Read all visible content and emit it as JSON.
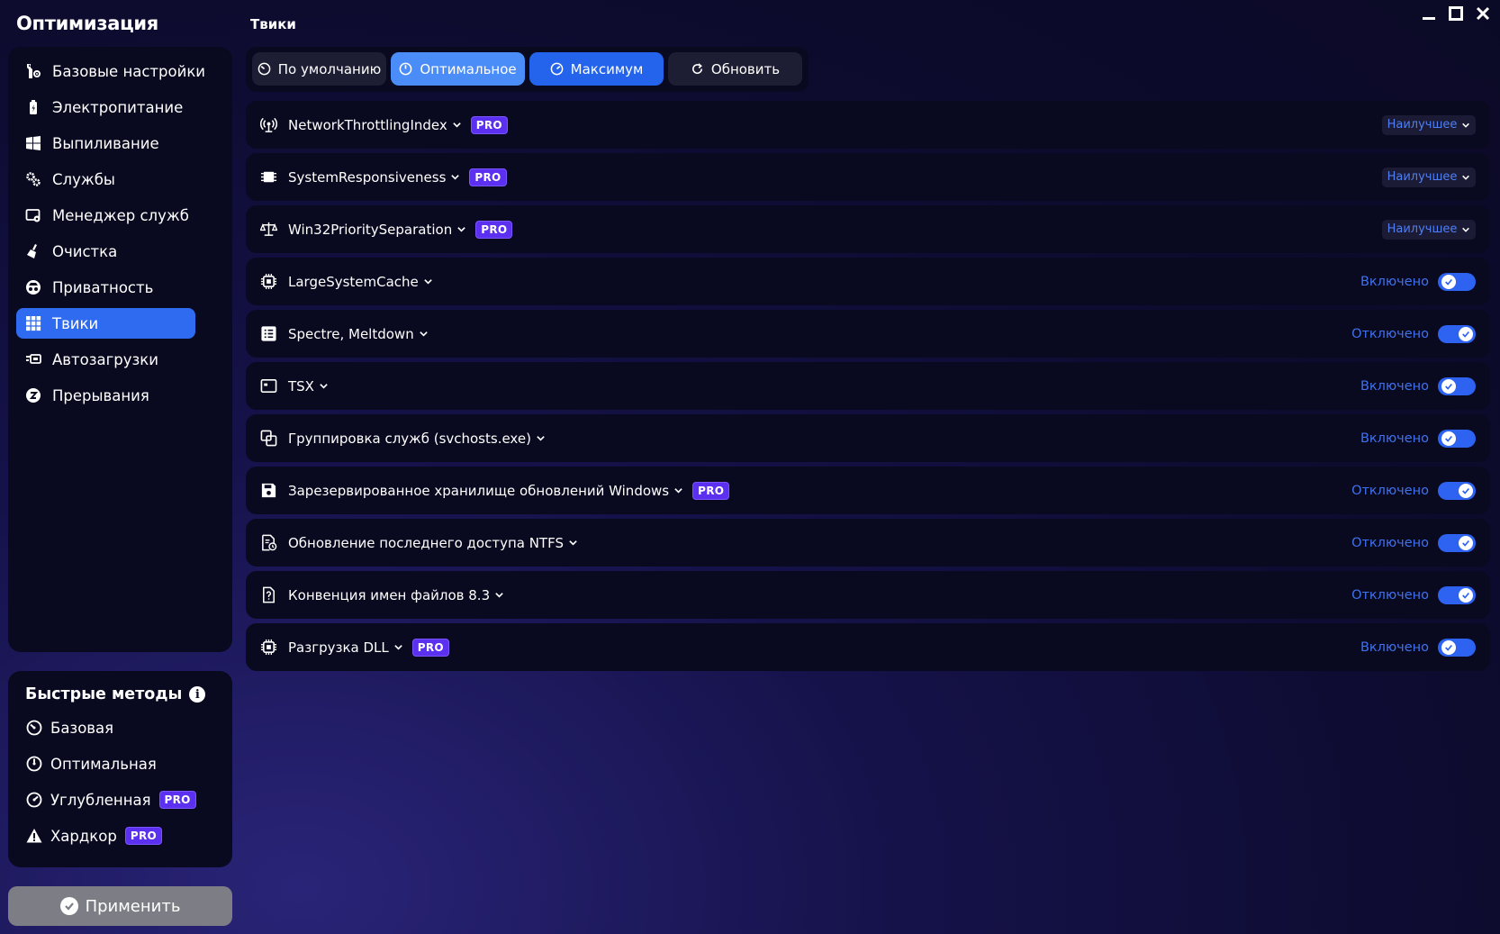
{
  "app": {
    "title": "Оптимизация",
    "section": "Твики"
  },
  "sidebar": {
    "items": [
      {
        "label": "Базовые настройки",
        "icon": "tools-icon"
      },
      {
        "label": "Электропитание",
        "icon": "battery-icon"
      },
      {
        "label": "Выпиливание",
        "icon": "windows-icon"
      },
      {
        "label": "Службы",
        "icon": "gears-icon"
      },
      {
        "label": "Менеджер служб",
        "icon": "service-manager-icon"
      },
      {
        "label": "Очистка",
        "icon": "broom-icon"
      },
      {
        "label": "Приватность",
        "icon": "incognito-icon"
      },
      {
        "label": "Твики",
        "icon": "grid-icon",
        "active": true
      },
      {
        "label": "Автозагрузки",
        "icon": "autostart-icon"
      },
      {
        "label": "Прерывания",
        "icon": "interrupt-icon"
      }
    ]
  },
  "quick": {
    "title": "Быстрые методы",
    "items": [
      {
        "label": "Базовая",
        "icon": "gauge-low-icon",
        "pro": false
      },
      {
        "label": "Оптимальная",
        "icon": "gauge-mid-icon",
        "pro": false
      },
      {
        "label": "Углубленная",
        "icon": "gauge-high-icon",
        "pro": true
      },
      {
        "label": "Хардкор",
        "icon": "warning-icon",
        "pro": true
      }
    ]
  },
  "pro_label": "PRO",
  "apply_label": "Применить",
  "presets": {
    "default": "По умолчанию",
    "optimal": "Оптимальное",
    "maximum": "Максимум",
    "refresh": "Обновить"
  },
  "tweaks": [
    {
      "name": "NetworkThrottlingIndex",
      "pro": true,
      "control": "select",
      "value": "Наилучшее",
      "icon": "network-icon"
    },
    {
      "name": "SystemResponsiveness",
      "pro": true,
      "control": "select",
      "value": "Наилучшее",
      "icon": "chip-icon"
    },
    {
      "name": "Win32PrioritySeparation",
      "pro": true,
      "control": "select",
      "value": "Наилучшее",
      "icon": "scales-icon"
    },
    {
      "name": "LargeSystemCache",
      "pro": false,
      "control": "toggle",
      "status": "Включено",
      "toggle": "off",
      "icon": "cpu-icon"
    },
    {
      "name": "Spectre, Meltdown",
      "pro": false,
      "control": "toggle",
      "status": "Отключено",
      "toggle": "on",
      "icon": "list-icon"
    },
    {
      "name": "TSX",
      "pro": false,
      "control": "toggle",
      "status": "Включено",
      "toggle": "off",
      "icon": "terminal-icon"
    },
    {
      "name": "Группировка служб (svchosts.exe)",
      "pro": false,
      "control": "toggle",
      "status": "Включено",
      "toggle": "off",
      "icon": "copy-icon"
    },
    {
      "name": "Зарезервированное хранилище обновлений Windows",
      "pro": true,
      "control": "toggle",
      "status": "Отключено",
      "toggle": "on",
      "icon": "save-icon"
    },
    {
      "name": "Обновление последнего доступа NTFS",
      "pro": false,
      "control": "toggle",
      "status": "Отключено",
      "toggle": "on",
      "icon": "file-clock-icon"
    },
    {
      "name": "Конвенция имен файлов 8.3",
      "pro": false,
      "control": "toggle",
      "status": "Отключено",
      "toggle": "on",
      "icon": "file-question-icon"
    },
    {
      "name": "Разгрузка DLL",
      "pro": true,
      "control": "toggle",
      "status": "Включено",
      "toggle": "off",
      "icon": "cpu-icon"
    }
  ],
  "colors": {
    "accent": "#2f6bf0",
    "pro": "#5b30f0",
    "panel": "#090920",
    "status": "#3f72f0"
  }
}
